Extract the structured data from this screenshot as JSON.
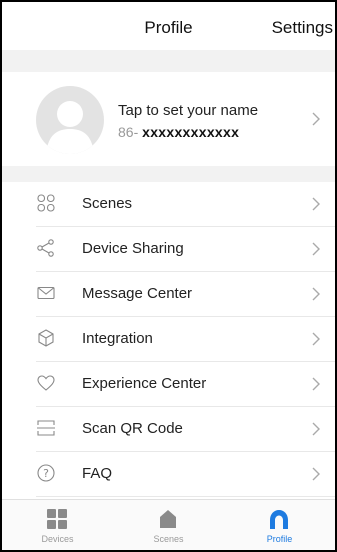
{
  "header": {
    "title": "Profile",
    "settings_label": "Settings"
  },
  "profile": {
    "name_prompt": "Tap to set your name",
    "phone_prefix": "86-",
    "phone_number": "xxxxxxxxxxxx"
  },
  "menu": [
    {
      "label": "Scenes",
      "icon": "scenes-icon"
    },
    {
      "label": "Device Sharing",
      "icon": "share-icon"
    },
    {
      "label": "Message Center",
      "icon": "mail-icon"
    },
    {
      "label": "Integration",
      "icon": "cube-icon"
    },
    {
      "label": "Experience Center",
      "icon": "heart-icon"
    },
    {
      "label": "Scan QR Code",
      "icon": "scan-icon"
    },
    {
      "label": "FAQ",
      "icon": "help-icon"
    }
  ],
  "tabs": [
    {
      "label": "Devices",
      "icon": "grid-icon"
    },
    {
      "label": "Scenes",
      "icon": "home-icon"
    },
    {
      "label": "Profile",
      "icon": "profile-icon",
      "active": true
    }
  ],
  "colors": {
    "accent": "#1e7be0",
    "section_gap": "#f2f2f2",
    "tab_inactive": "#9a9a9a"
  }
}
